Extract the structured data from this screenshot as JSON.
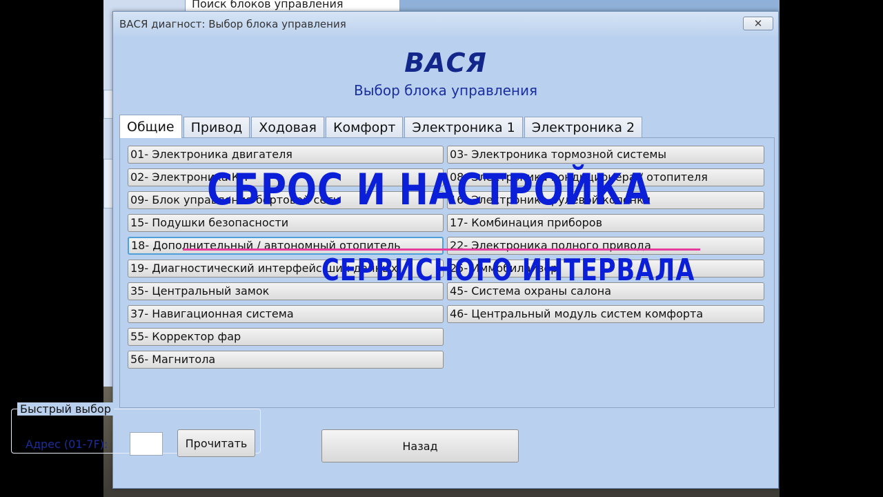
{
  "background": {
    "window_title": "Поиск блоков управления"
  },
  "window": {
    "title": "ВАСЯ диагност: Выбор блока управления",
    "close_symbol": "✕"
  },
  "header": {
    "brand": "ВАСЯ",
    "subtitle": "Выбор блока управления"
  },
  "tabs": [
    {
      "label": "Общие",
      "active": true
    },
    {
      "label": "Привод",
      "active": false
    },
    {
      "label": "Ходовая",
      "active": false
    },
    {
      "label": "Комфорт",
      "active": false
    },
    {
      "label": "Электроника 1",
      "active": false
    },
    {
      "label": "Электроника 2",
      "active": false
    }
  ],
  "modules_left": [
    "01- Электроника двигателя",
    "02- Электроника КП",
    "09- Блок управления бортовой сети",
    "15- Подушки безопасности",
    "18- Дополнительный / автономный отопитель",
    "19- Диагностический интерфейс шин данных",
    "35- Центральный замок",
    "37- Навигационная система",
    "55- Корректор фар",
    "56- Магнитола"
  ],
  "modules_right": [
    "03- Электроника тормозной системы",
    "08- Электроника кондиционера / отопителя",
    "16- Электроника рулевой колонки",
    "17- Комбинация приборов",
    "22- Электроника полного привода",
    "25- Иммобилайзер",
    "45- Система охраны салона",
    "46- Центральный модуль систем комфорта"
  ],
  "quick_select": {
    "legend": "Быстрый выбор",
    "address_label": "Адрес (01-7F):",
    "address_value": "",
    "read_button": "Прочитать"
  },
  "back_button": "Назад",
  "overlay": {
    "line1": "СБРОС И НАСТРОЙКА",
    "line2": "СЕРВИСНОГО ИНТЕРВАЛА",
    "accent_color": "#e83c9c",
    "text_color": "#0b1fd8"
  }
}
